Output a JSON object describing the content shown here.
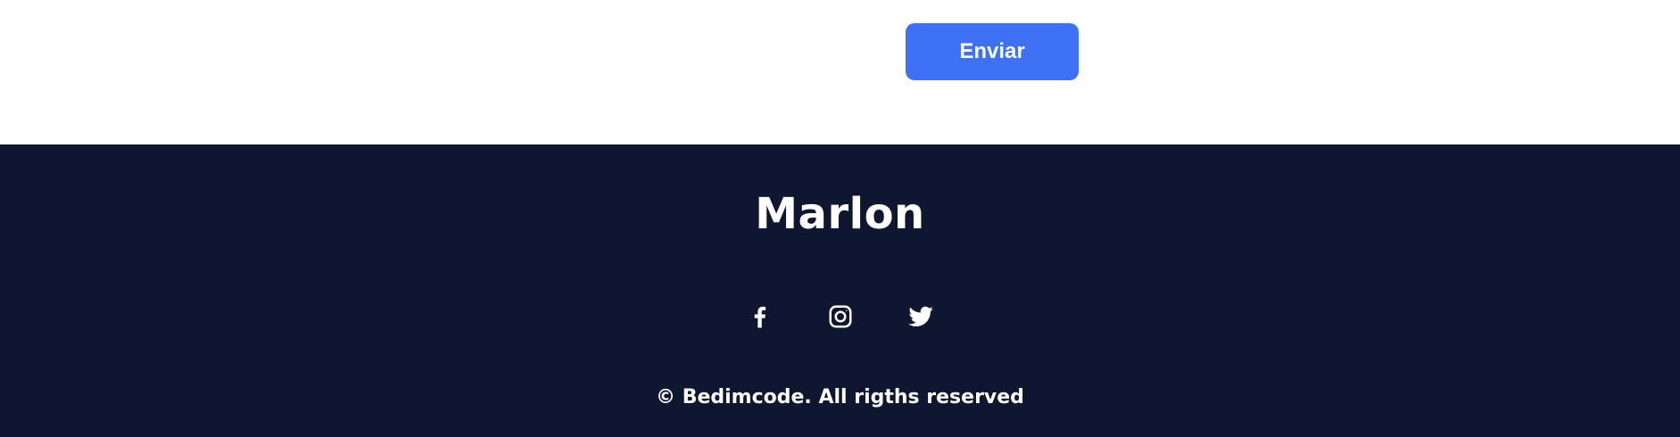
{
  "form": {
    "submit_label": "Enviar"
  },
  "footer": {
    "title": "Marlon",
    "social": [
      {
        "icon": "facebook-icon"
      },
      {
        "icon": "instagram-icon"
      },
      {
        "icon": "twitter-icon"
      }
    ],
    "copyright": "© Bedimcode. All rigths reserved"
  },
  "colors": {
    "accent": "#4070f4",
    "footer_bg": "#0e1630",
    "text_light": "#ffffff"
  }
}
